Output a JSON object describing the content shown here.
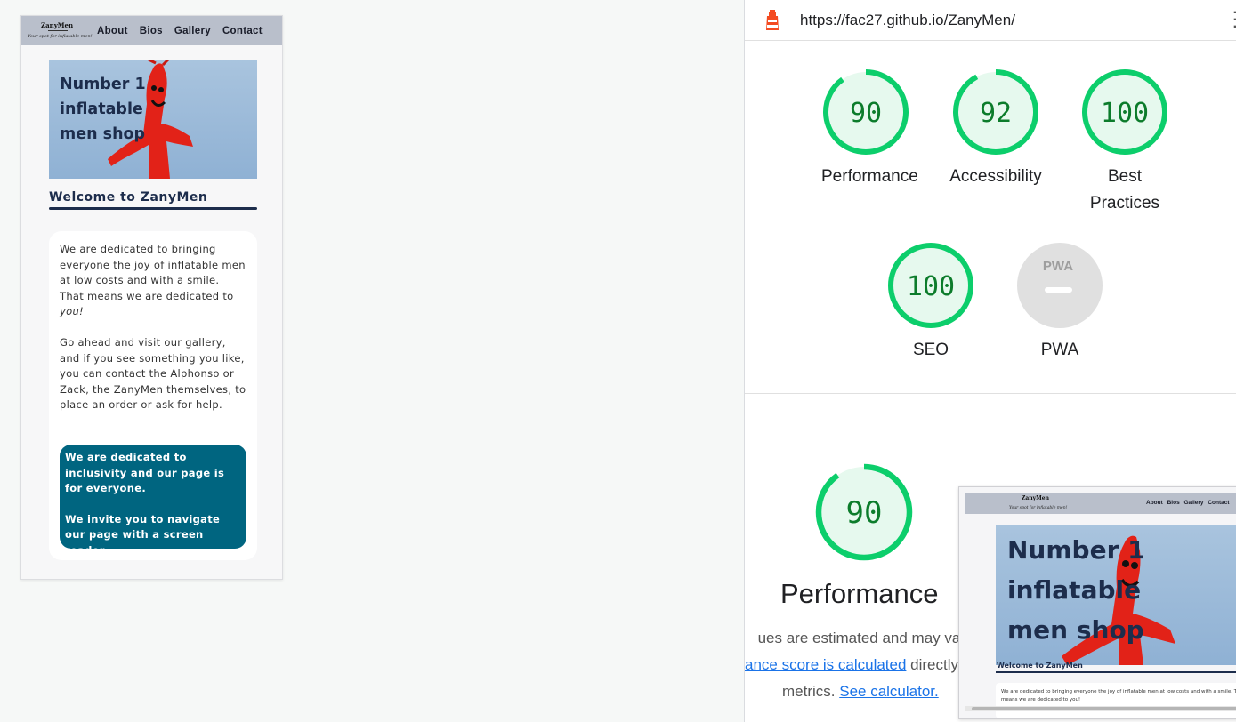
{
  "site": {
    "logo_name": "ZanyMen",
    "logo_tagline": "Your spot for inflatable men!",
    "nav": [
      "About",
      "Bios",
      "Gallery",
      "Contact"
    ],
    "hero_text": "Number 1 inflatable men shop",
    "welcome": "Welcome to ZanyMen",
    "intro_1a": "We are dedicated to bringing everyone the joy of inflatable men at low costs and with a smile. That means we are dedicated to ",
    "intro_1b": "you!",
    "intro_2": "Go ahead and visit our gallery, and if you see something you like, you can contact the Alphonso or Zack, the ZanyMen themselves, to place an order or ask for help.",
    "callout_1": "We are dedicated to inclusivity and our page is for everyone.",
    "callout_2": "We invite you to navigate our page with a screen reader.",
    "thumb_intro": "We are dedicated to bringing everyone the joy of inflatable men at low costs and with a smile. That means we are dedicated to you!"
  },
  "report": {
    "url": "https://fac27.github.io/ZanyMen/",
    "categories": [
      {
        "label": "Performance",
        "score": "90",
        "value": 0.9
      },
      {
        "label": "Accessibility",
        "score": "92",
        "value": 0.92
      },
      {
        "label": "Best Practices",
        "score": "100",
        "value": 1.0
      },
      {
        "label": "SEO",
        "score": "100",
        "value": 1.0
      },
      {
        "label": "PWA",
        "score": "",
        "badge": "PWA"
      }
    ],
    "section_title": "Performance",
    "section_score": "90",
    "section_value": 0.9,
    "desc_line1": "ues are estimated and may var",
    "desc_link1": "ance score is calculated",
    "desc_line2": " directly",
    "desc_line3": "metrics. ",
    "desc_link2": "See calculator.",
    "colors": {
      "pass": "#0cce6b",
      "pass_text": "#0c7c2b",
      "pass_fill": "#e6f9ee",
      "na": "#e0e0e0",
      "link": "#1a73e8",
      "callout": "#006580",
      "navy": "#1d2d4c"
    }
  }
}
